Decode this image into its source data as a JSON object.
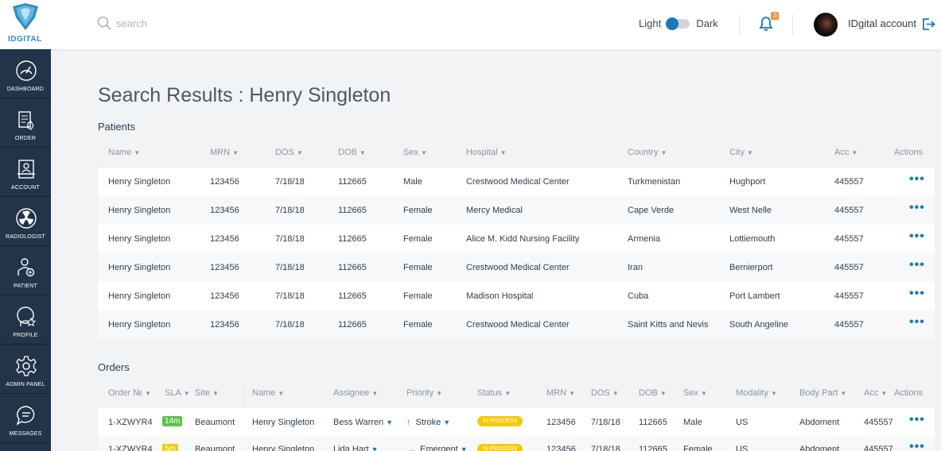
{
  "brand": {
    "logo_text": "IDGITAL"
  },
  "search": {
    "placeholder": "search"
  },
  "theme": {
    "light_label": "Light",
    "dark_label": "Dark"
  },
  "notifications": {
    "count": "3"
  },
  "account": {
    "name": "IDgital account"
  },
  "sidebar": {
    "items": [
      {
        "label": "DASHBOARD",
        "icon": "dashboard-gauge-icon"
      },
      {
        "label": "ORDER",
        "icon": "order-clipboard-icon"
      },
      {
        "label": "ACCOUNT",
        "icon": "account-card-icon"
      },
      {
        "label": "RADIOLOGIST",
        "icon": "radiation-icon"
      },
      {
        "label": "PATIENT",
        "icon": "patient-icon"
      },
      {
        "label": "PROFILE",
        "icon": "profile-star-icon"
      },
      {
        "label": "ADMIN PANEL",
        "icon": "gear-icon"
      },
      {
        "label": "MESSAGES",
        "icon": "chat-bubble-icon"
      }
    ]
  },
  "page": {
    "title": "Search Results : Henry Singleton"
  },
  "patients": {
    "title": "Patients",
    "columns": [
      "Name",
      "MRN",
      "DOS",
      "DOB",
      "Sex",
      "Hospital",
      "Country",
      "City",
      "Acc",
      "Actions"
    ],
    "rows": [
      [
        "Henry Singleton",
        "123456",
        "7/18/18",
        "112665",
        "Male",
        "Crestwood Medical Center",
        "Turkmenistan",
        "Hughport",
        "445557"
      ],
      [
        "Henry Singleton",
        "123456",
        "7/18/18",
        "112665",
        "Female",
        "Mercy Medical",
        "Cape Verde",
        "West Nelle",
        "445557"
      ],
      [
        "Henry Singleton",
        "123456",
        "7/18/18",
        "112665",
        "Female",
        "Alice M. Kidd Nursing Facility",
        "Armenia",
        "Lottiemouth",
        "445557"
      ],
      [
        "Henry Singleton",
        "123456",
        "7/18/18",
        "112665",
        "Female",
        "Crestwood Medical Center",
        "Iran",
        "Bernierport",
        "445557"
      ],
      [
        "Henry Singleton",
        "123456",
        "7/18/18",
        "112665",
        "Female",
        "Madison Hospital",
        "Cuba",
        "Port Lambert",
        "445557"
      ],
      [
        "Henry Singleton",
        "123456",
        "7/18/18",
        "112665",
        "Female",
        "Crestwood Medical Center",
        "Saint Kitts and Nevis",
        "South Angeline",
        "445557"
      ]
    ]
  },
  "orders": {
    "title": "Orders",
    "columns": [
      "Order №",
      "SLA",
      "Site",
      "Name",
      "Assignee",
      "Priority",
      "Status",
      "MRN",
      "DOS",
      "DOB",
      "Sex",
      "Modality",
      "Body Part",
      "Acc",
      "Actions"
    ],
    "rows": [
      {
        "order": "1-XZWYR4",
        "sla": "14m",
        "sla_color": "#5cc24a",
        "site": "Beaumont",
        "name": "Henry Singleton",
        "assignee": "Bess Warren",
        "priority": "Stroke",
        "priority_color": "#e8413c",
        "status": "IN PROCESS",
        "mrn": "123456",
        "dos": "7/18/18",
        "dob": "112665",
        "sex": "Male",
        "modality": "US",
        "body_part": "Abdoment",
        "acc": "445557"
      },
      {
        "order": "1-XZWYR4",
        "sla": "5m",
        "sla_color": "#f7c900",
        "site": "Beaumont",
        "name": "Henry Singleton",
        "assignee": "Lida Hart",
        "priority": "Emergent",
        "priority_color": "#f4913a",
        "status": "IN PROCESS",
        "mrn": "123456",
        "dos": "7/18/18",
        "dob": "112665",
        "sex": "Female",
        "modality": "US",
        "body_part": "Abdoment",
        "acc": "445557"
      }
    ]
  },
  "colors": {
    "sidebar": "#21344a",
    "accent": "#1a79b8",
    "status_yellow": "#f7c900",
    "badge_orange": "#f4913a"
  }
}
